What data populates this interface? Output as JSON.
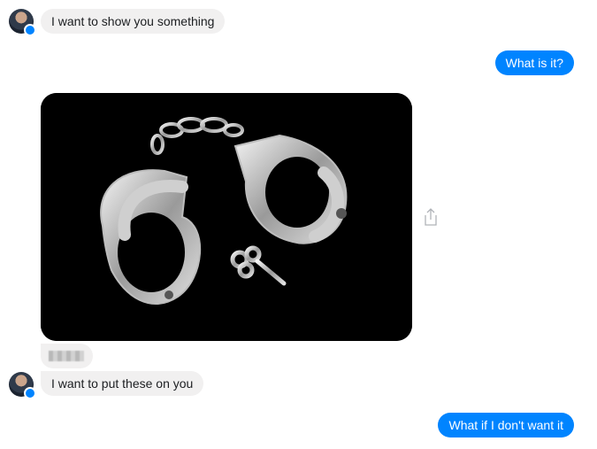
{
  "conversation": {
    "messages": [
      {
        "sender": "contact",
        "text": "I want to show you something"
      },
      {
        "sender": "me",
        "text": "What is it?"
      },
      {
        "sender": "contact",
        "type": "image",
        "image_subject": "pair of handcuffs with key"
      },
      {
        "sender": "contact",
        "type": "redacted"
      },
      {
        "sender": "contact",
        "text": "I want to put these on you"
      },
      {
        "sender": "me",
        "text": "What if I don't want it"
      }
    ]
  },
  "icons": {
    "share": "share-icon",
    "verified": "messenger-badge-icon"
  },
  "colors": {
    "outgoing_bubble": "#0084ff",
    "incoming_bubble": "#f1f0f0",
    "background": "#ffffff"
  }
}
